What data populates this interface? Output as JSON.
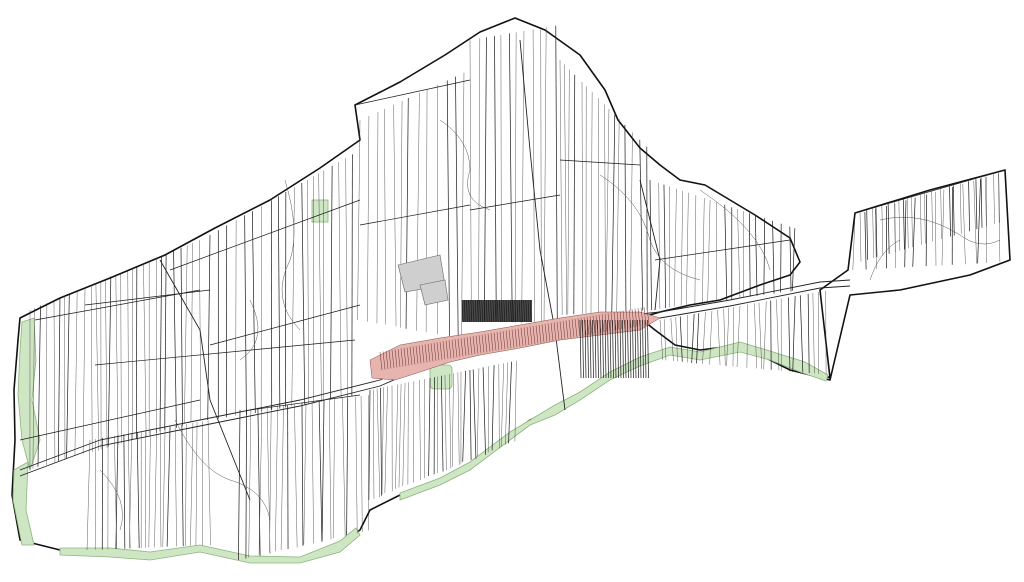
{
  "map": {
    "type": "cadastral-parcel-map",
    "colors": {
      "background": "#ffffff",
      "boundary": "#111111",
      "parcel_lines": "#1a1a1a",
      "green_areas": "#cfe6c4",
      "built_up_area": "#e7b5b0",
      "built_up_outline": "#8d4a44",
      "gray_area": "#cfcfcf"
    },
    "layers": [
      "municipal-boundary",
      "parcel-strips",
      "roads",
      "contours",
      "green-areas",
      "built-up-area",
      "dense-parcels"
    ]
  }
}
